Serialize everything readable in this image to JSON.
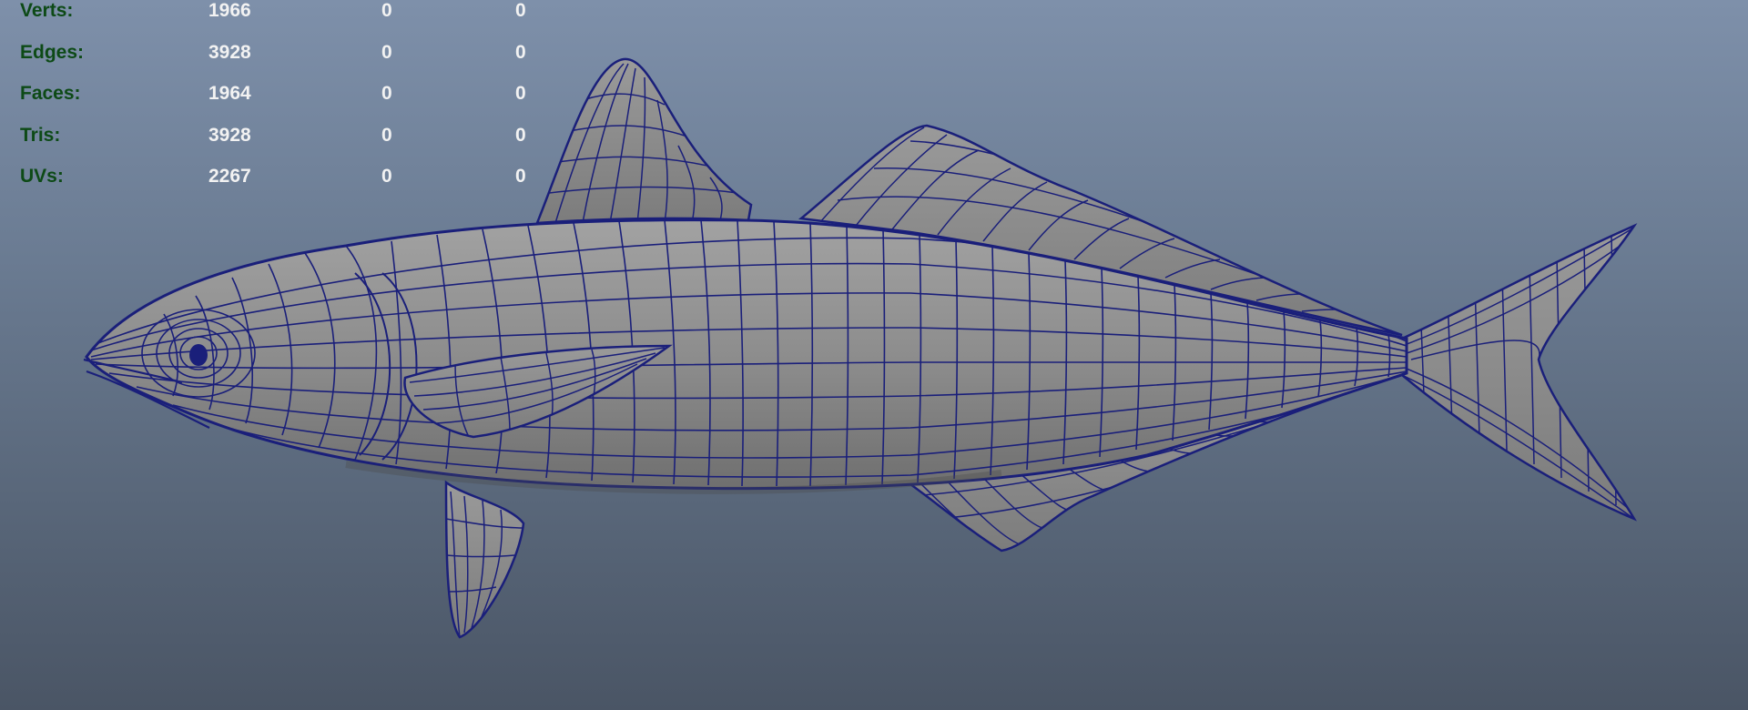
{
  "viewport": {
    "background_top": "#7e90aa",
    "background_bottom": "#4a5565",
    "mesh_fill": "#8a8a8a",
    "wire_color": "#1a1f7a"
  },
  "heads_up_display": {
    "label_color": "#0d4a16",
    "value_color": "#f2f2f2",
    "rows": [
      {
        "label": "Verts:",
        "total": "1966",
        "selected": "0",
        "selected_other": "0"
      },
      {
        "label": "Edges:",
        "total": "3928",
        "selected": "0",
        "selected_other": "0"
      },
      {
        "label": "Faces:",
        "total": "1964",
        "selected": "0",
        "selected_other": "0"
      },
      {
        "label": "Tris:",
        "total": "3928",
        "selected": "0",
        "selected_other": "0"
      },
      {
        "label": "UVs:",
        "total": "2267",
        "selected": "0",
        "selected_other": "0"
      }
    ]
  }
}
